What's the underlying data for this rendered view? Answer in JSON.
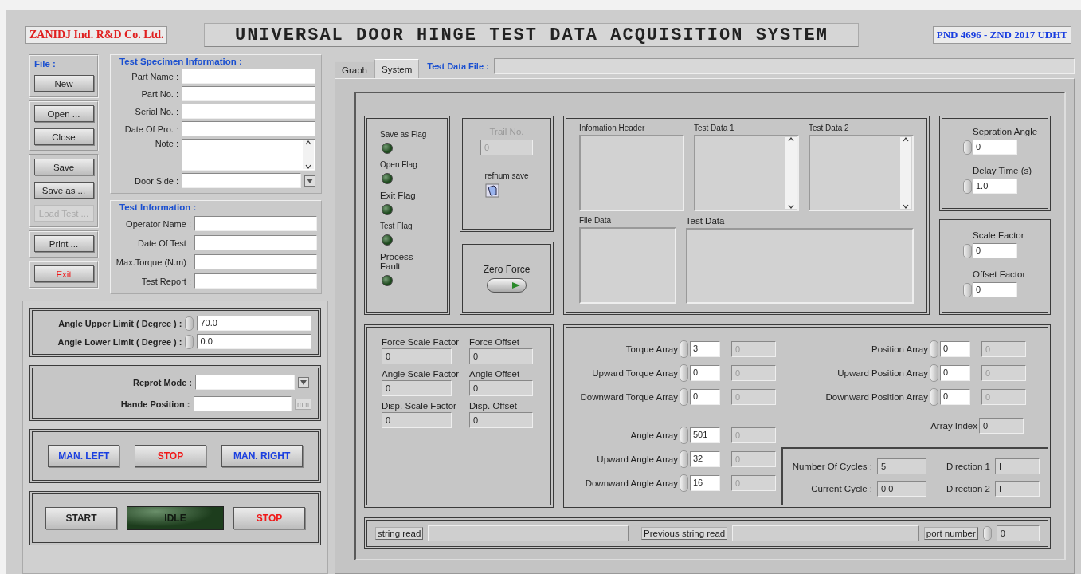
{
  "company": "ZANIDJ Ind. R&D Co. Ltd.",
  "title": "UNIVERSAL DOOR HINGE TEST DATA ACQUISITION SYSTEM",
  "code": "PND 4696 - ZND 2017 UDHT",
  "file_menu": {
    "label": "File :",
    "groups": [
      [
        {
          "label": "New",
          "kind": "plain",
          "disabled": false
        }
      ],
      [
        {
          "label": "Open ...",
          "kind": "plain",
          "disabled": false
        },
        {
          "label": "Close",
          "kind": "plain",
          "disabled": false
        }
      ],
      [
        {
          "label": "Save",
          "kind": "plain",
          "disabled": false
        },
        {
          "label": "Save as ...",
          "kind": "plain",
          "disabled": false
        },
        {
          "label": "Load Test ...",
          "kind": "plain",
          "disabled": true
        }
      ],
      [
        {
          "label": "Print ...",
          "kind": "plain",
          "disabled": false
        }
      ],
      [
        {
          "label": "Exit",
          "kind": "red",
          "disabled": false
        }
      ]
    ]
  },
  "specimen": {
    "title": "Test Specimen Information :",
    "fields": [
      {
        "label": "Part Name :",
        "kind": "text"
      },
      {
        "label": "Part No. :",
        "kind": "text"
      },
      {
        "label": "Serial No. :",
        "kind": "text"
      },
      {
        "label": "Date Of Pro. :",
        "kind": "text"
      },
      {
        "label": "Note :",
        "kind": "textarea"
      },
      {
        "label": "Door Side :",
        "kind": "dropdown"
      }
    ]
  },
  "test_info": {
    "title": "Test Information :",
    "fields": [
      {
        "label": "Operator Name :"
      },
      {
        "label": "Date Of Test :"
      },
      {
        "label": "Max.Torque (N.m) :"
      },
      {
        "label": "Test  Report :"
      }
    ]
  },
  "angle_limits": [
    {
      "label": "Angle Upper Limit ( Degree ) :",
      "value": "70.0"
    },
    {
      "label": "Angle Lower Limit ( Degree ) :",
      "value": "0.0"
    }
  ],
  "report": [
    {
      "label": "Reprot  Mode :",
      "kind": "dropdown"
    },
    {
      "label": "Hande Position :",
      "kind": "unit",
      "unit": "mm"
    }
  ],
  "manual_buttons": [
    {
      "label": "MAN. LEFT",
      "kind": "blue"
    },
    {
      "label": "STOP",
      "kind": "red"
    },
    {
      "label": "MAN. RIGHT",
      "kind": "blue"
    }
  ],
  "run_controls": [
    {
      "label": "START",
      "kind": "plain"
    },
    {
      "label": "IDLE",
      "kind": "indicator"
    },
    {
      "label": "STOP",
      "kind": "red"
    }
  ],
  "tabs": [
    {
      "label": "Graph",
      "selected": false
    },
    {
      "label": "System",
      "selected": true
    }
  ],
  "test_data_file": {
    "label": "Test Data File :"
  },
  "flags": [
    {
      "label": "Save as Flag",
      "on": false
    },
    {
      "label": "Open Flag",
      "on": false
    },
    {
      "label": "Exit Flag",
      "on": false
    },
    {
      "label": "Test Flag",
      "on": false
    },
    {
      "label": "Process Fault",
      "on": false
    }
  ],
  "trail_no": {
    "label": "Trail No.",
    "value": "0"
  },
  "refnum": {
    "label": "refnum save"
  },
  "zero_force": {
    "label": "Zero Force",
    "on": false
  },
  "data_top": [
    {
      "label": "Infomation Header",
      "scroll": false
    },
    {
      "label": "Test Data 1",
      "scroll": true
    },
    {
      "label": "Test Data 2",
      "scroll": true
    }
  ],
  "data_bottom": [
    {
      "label": "File Data"
    },
    {
      "label": "Test Data"
    }
  ],
  "timing": [
    {
      "label": "Sepration Angle",
      "value": "0"
    },
    {
      "label": "Delay Time (s)",
      "value": "1.0"
    }
  ],
  "scaling": [
    {
      "label": "Scale Factor",
      "value": "0"
    },
    {
      "label": "Offset Factor",
      "value": "0"
    }
  ],
  "calibration": [
    {
      "label": "Force Scale Factor",
      "value": "0"
    },
    {
      "label": "Force Offset",
      "value": "0"
    },
    {
      "label": "Angle Scale Factor",
      "value": "0"
    },
    {
      "label": "Angle Offset",
      "value": "0"
    },
    {
      "label": "Disp. Scale Factor",
      "value": "0"
    },
    {
      "label": "Disp. Offset",
      "value": "0"
    }
  ],
  "torque_arrays": [
    {
      "label": "Torque Array",
      "index": "3",
      "value": "0"
    },
    {
      "label": "Upward Torque Array",
      "index": "0",
      "value": "0"
    },
    {
      "label": "Downward Torque Array",
      "index": "0",
      "value": "0"
    }
  ],
  "angle_arrays": [
    {
      "label": "Angle Array",
      "index": "501",
      "value": "0"
    },
    {
      "label": "Upward Angle Array",
      "index": "32",
      "value": "0"
    },
    {
      "label": "Downward Angle Array",
      "index": "16",
      "value": "0"
    }
  ],
  "position_arrays": [
    {
      "label": "Position Array",
      "index": "0",
      "value": "0"
    },
    {
      "label": "Upward  Position Array",
      "index": "0",
      "value": "0"
    },
    {
      "label": "Downward Position Array",
      "index": "0",
      "value": "0"
    }
  ],
  "array_index": {
    "label": "Array Index",
    "value": "0"
  },
  "cycles": [
    {
      "label": "Number Of Cycles :",
      "value": "5"
    },
    {
      "label": "Direction 1",
      "value": "I"
    },
    {
      "label": "Current Cycle :",
      "value": "0.0"
    },
    {
      "label": "Direction 2",
      "value": "I"
    }
  ],
  "serial": {
    "string_read": "string read",
    "previous": "Previous string read",
    "port_label": "port number",
    "port_value": "0"
  }
}
